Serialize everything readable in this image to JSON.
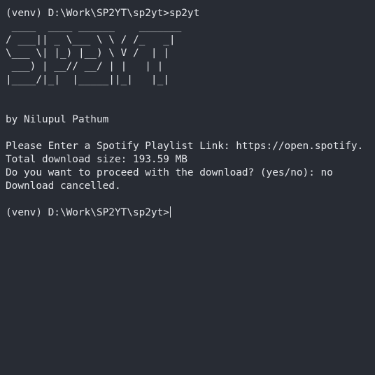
{
  "terminal": {
    "command_line": "(venv) D:\\Work\\SP2YT\\sp2yt>sp2yt",
    "banner": [
      " ____  ____ ______    _______",
      "/ ___|| _ \\___ \\ \\ / /_   _|",
      "\\___ \\| |_) |__) \\ V /  | |",
      " ___) | __// __/ | |   | |",
      "|____/|_|  |_____||_|   |_|"
    ],
    "author": "by Nilupul Pathum",
    "playlist_prompt": "Please Enter a Spotify Playlist Link: https://open.spotify.",
    "download_size": "Total download size: 193.59 MB",
    "proceed_prompt": "Do you want to proceed with the download? (yes/no): no",
    "cancel_message": "Download cancelled.",
    "final_prompt": "(venv) D:\\Work\\SP2YT\\sp2yt>"
  }
}
